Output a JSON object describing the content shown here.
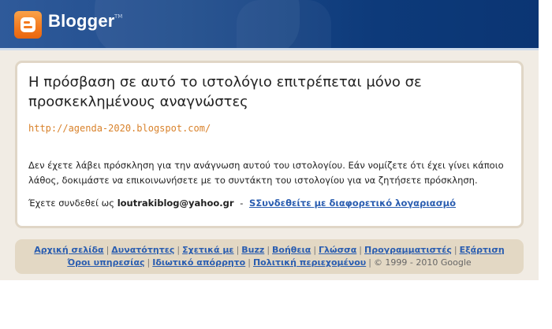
{
  "header": {
    "logo_text": "Blogger",
    "logo_tm": "TM",
    "brand_color": "#f37a1f"
  },
  "main": {
    "title": "Η πρόσβαση σε αυτό το ιστολόγιο επιτρέπεται μόνο σε προσκεκλημένους αναγνώστες",
    "blog_url": "http://agenda-2020.blogspot.com/",
    "message": "Δεν έχετε λάβει πρόσκληση για την ανάγνωση αυτού του ιστολογίου. Εάν νομίζετε ότι έχει γίνει κάποιο λάθος, δοκιμάστε να επικοινωνήσετε με το συντάκτη του ιστολογίου για να ζητήσετε πρόσκληση.",
    "signed_in_prefix": "Έχετε συνδεθεί ως",
    "signed_in_email": "loutrakiblog@yahoo.gr",
    "separator": "-",
    "switch_account_link": "SΣυνδεθείτε με διαφορετικό λογαριασμό"
  },
  "footer": {
    "row1": [
      "Αρχική σελίδα",
      "Δυνατότητες",
      "Σχετικά με",
      "Buzz",
      "Βοήθεια",
      "Γλώσσα",
      "Προγραμματιστές",
      "Εξάρτιση"
    ],
    "row2": [
      "Όροι υπηρεσίας",
      "Ιδιωτικό απόρρητο",
      "Πολιτική περιεχομένου"
    ],
    "copyright": "© 1999 - 2010 Google",
    "pipe": "|"
  }
}
